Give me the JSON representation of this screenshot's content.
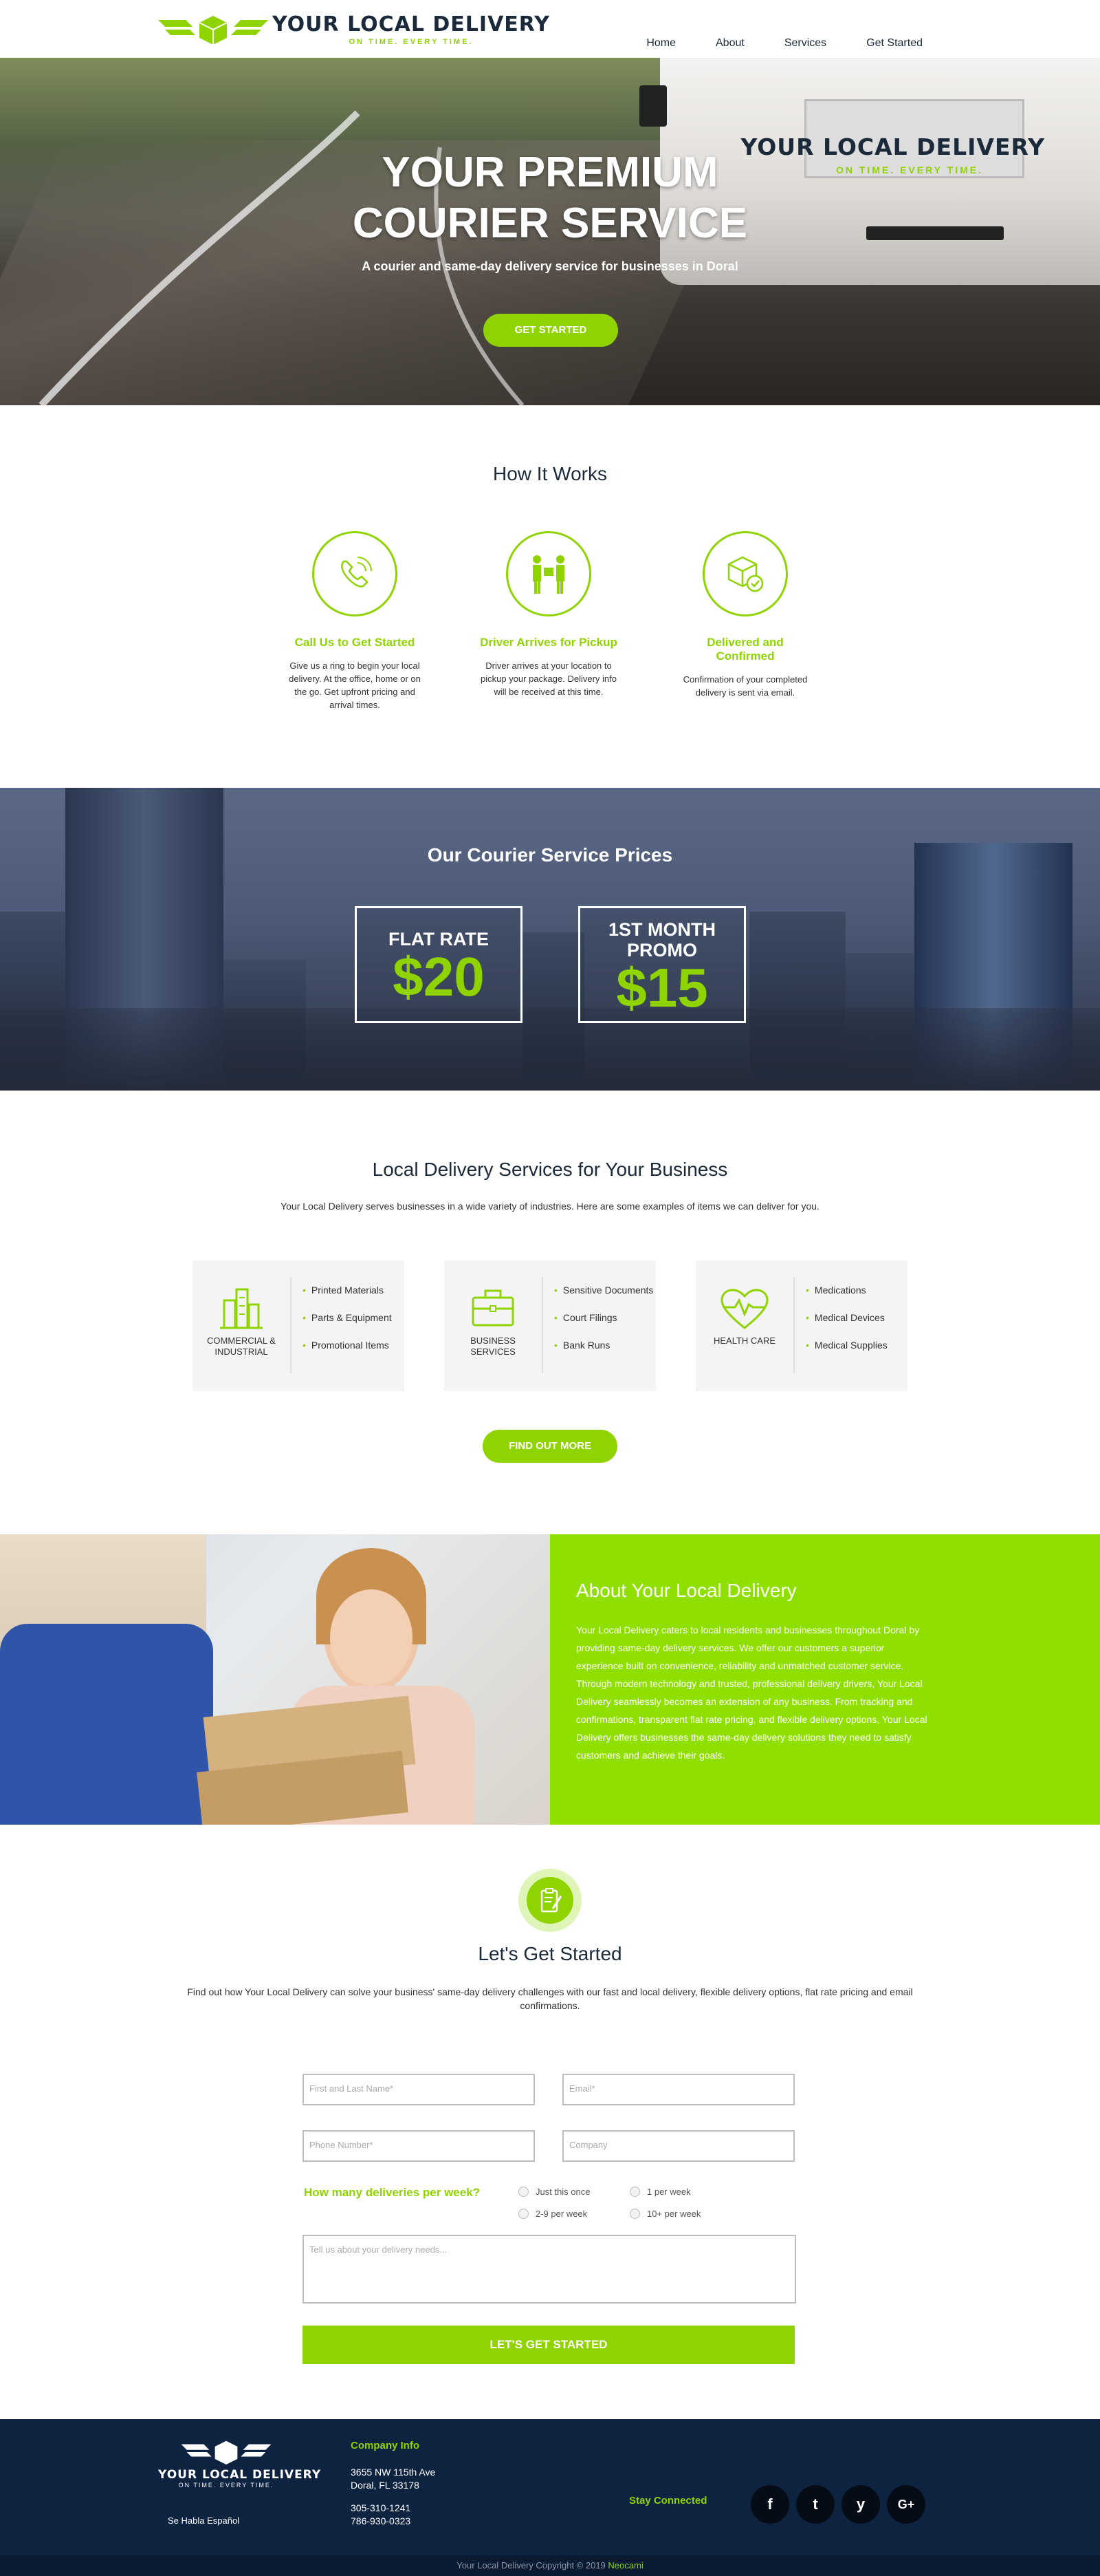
{
  "header": {
    "logo_text": "YOUR LOCAL DELIVERY",
    "logo_tagline": "ON TIME. EVERY TIME.",
    "nav": [
      "Home",
      "About",
      "Services",
      "Get Started"
    ]
  },
  "hero": {
    "title_line1": "YOUR PREMIUM",
    "title_line2": "COURIER SERVICE",
    "subtitle": "A courier and same-day delivery service for businesses in Doral",
    "cta": "GET STARTED",
    "van_logo_text": "YOUR LOCAL DELIVERY",
    "van_logo_tagline": "ON TIME. EVERY TIME."
  },
  "how_it_works": {
    "title": "How It Works",
    "steps": [
      {
        "icon": "phone-icon",
        "title": "Call Us to Get Started",
        "text": "Give us a ring to begin your local delivery. At the office, home or on the go. Get upfront pricing and arrival times."
      },
      {
        "icon": "package-handoff-icon",
        "title": "Driver Arrives for Pickup",
        "text": "Driver arrives at your location to pickup your package. Delivery info will be received at this time."
      },
      {
        "icon": "box-check-icon",
        "title": "Delivered and Confirmed",
        "text": "Confirmation of your completed delivery is sent via email."
      }
    ]
  },
  "prices": {
    "title": "Our Courier Service Prices",
    "boxes": [
      {
        "label": "FLAT RATE",
        "price": "$20"
      },
      {
        "label_line1": "1ST MONTH",
        "label_line2": "PROMO",
        "price": "$15"
      }
    ]
  },
  "services": {
    "title": "Local Delivery Services for Your Business",
    "intro": "Your Local Delivery serves businesses in a wide variety of industries. Here are some examples of items we can deliver for you.",
    "cards": [
      {
        "icon": "building-icon",
        "label_line1": "COMMERCIAL &",
        "label_line2": "INDUSTRIAL",
        "items": [
          "Printed Materials",
          "Parts & Equipment",
          "Promotional Items"
        ]
      },
      {
        "icon": "briefcase-icon",
        "label_line1": "BUSINESS",
        "label_line2": "SERVICES",
        "items": [
          "Sensitive Documents",
          "Court Filings",
          "Bank Runs"
        ]
      },
      {
        "icon": "heart-pulse-icon",
        "label_line1": "HEALTH CARE",
        "label_line2": "",
        "items": [
          "Medications",
          "Medical Devices",
          "Medical Supplies"
        ]
      }
    ],
    "cta": "FIND OUT MORE"
  },
  "about": {
    "title": "About Your Local Delivery",
    "text": "Your Local Delivery caters to local residents and businesses throughout Doral by providing same-day delivery services. We offer our customers a superior experience built on convenience, reliability and unmatched customer service. Through modern technology and trusted, professional delivery drivers, Your Local Delivery seamlessly becomes an extension of any business. From tracking and confirmations, transparent flat rate pricing, and flexible delivery options, Your Local Delivery offers businesses the same-day delivery solutions they need to satisfy customers and achieve their goals."
  },
  "get_started": {
    "title": "Let's Get Started",
    "intro": "Find out how Your Local Delivery can solve your business' same-day delivery challenges with our fast and local delivery, flexible delivery options, flat rate pricing and email confirmations.",
    "name_placeholder": "First and Last Name*",
    "email_placeholder": "Email*",
    "phone_placeholder": "Phone Number*",
    "company_placeholder": "Company",
    "question": "How many deliveries per week?",
    "options": [
      "Just this once",
      "1 per week",
      "2-9 per week",
      "10+ per week"
    ],
    "message_placeholder": "Tell us about your delivery needs...",
    "submit": "LET'S GET STARTED"
  },
  "footer": {
    "logo_text": "YOUR LOCAL DELIVERY",
    "logo_tagline": "ON TIME. EVERY TIME.",
    "spanish": "Se Habla Español",
    "info_title": "Company Info",
    "address_line1": "3655 NW 115th Ave",
    "address_line2": "Doral, FL 33178",
    "phone1": "305-310-1241",
    "phone2": "786-930-0323",
    "stay_connected": "Stay Connected",
    "social": [
      {
        "icon": "facebook-icon",
        "glyph": "f"
      },
      {
        "icon": "twitter-icon",
        "glyph": "t"
      },
      {
        "icon": "yelp-icon",
        "glyph": "y"
      },
      {
        "icon": "google-plus-icon",
        "glyph": "G+"
      }
    ],
    "copyright": "Your Local Delivery Copyright © 2019",
    "credit": "Neocami"
  },
  "colors": {
    "accent": "#8fd400",
    "navy": "#0d2340",
    "text_dark": "#1b2a3a"
  }
}
